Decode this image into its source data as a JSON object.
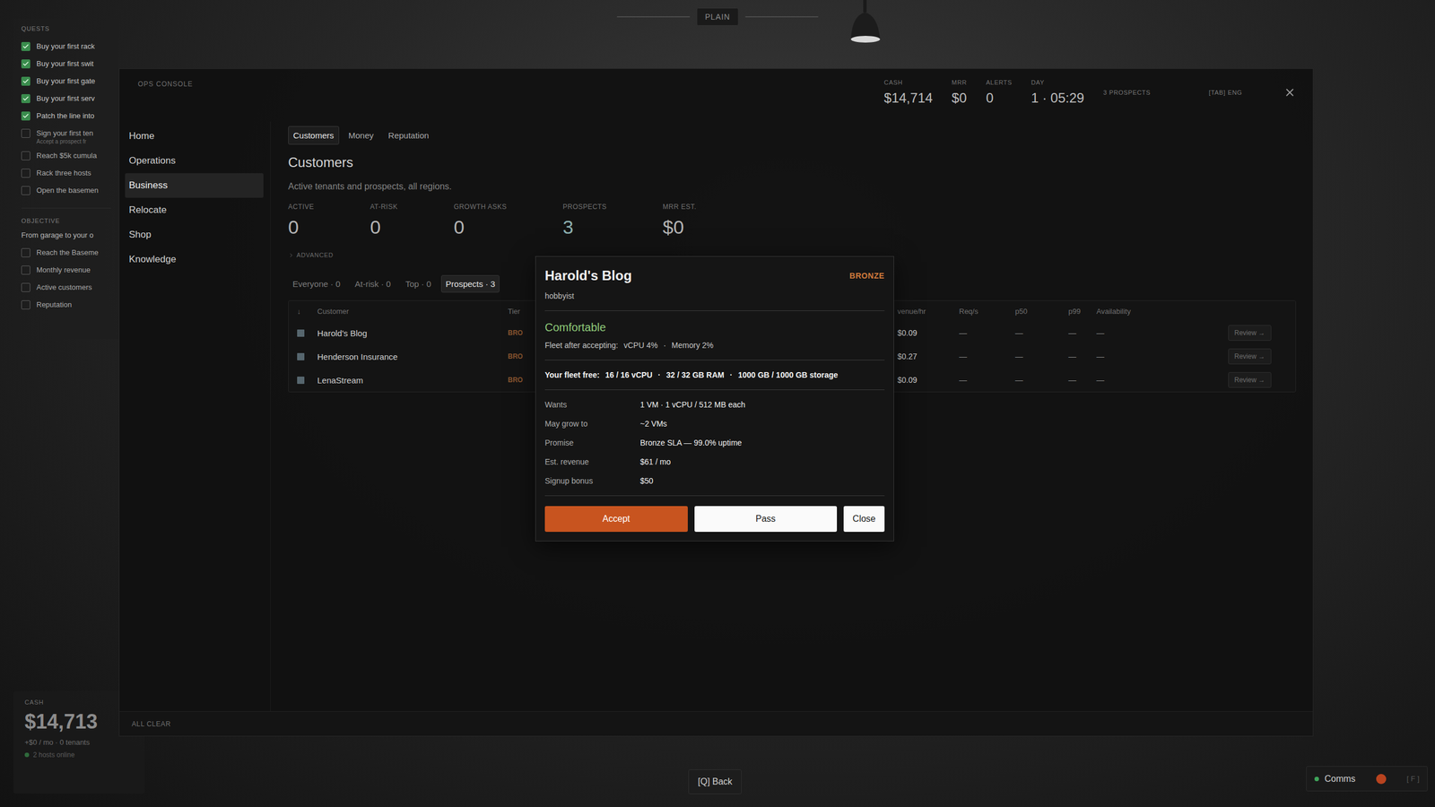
{
  "scene": {
    "mode_pill": "PLAIN"
  },
  "quests": {
    "title": "QUESTS",
    "items": [
      {
        "label": "Buy your first rack",
        "checked": true
      },
      {
        "label": "Buy your first swit",
        "checked": true
      },
      {
        "label": "Buy your first gate",
        "checked": true
      },
      {
        "label": "Buy your first serv",
        "checked": true
      },
      {
        "label": "Patch the line into",
        "checked": true
      },
      {
        "label": "Sign your first ten",
        "checked": false,
        "hint": "Accept a prospect fr"
      },
      {
        "label": "Reach $5k cumula",
        "checked": false
      },
      {
        "label": "Rack three hosts",
        "checked": false
      },
      {
        "label": "Open the basemen",
        "checked": false
      }
    ]
  },
  "objective": {
    "title": "OBJECTIVE",
    "name": "From garage to your o",
    "items": [
      {
        "label": "Reach the Baseme",
        "checked": false
      },
      {
        "label": "Monthly revenue",
        "checked": false
      },
      {
        "label": "Active customers",
        "checked": false
      },
      {
        "label": "Reputation",
        "checked": false
      }
    ]
  },
  "hud_cash": {
    "label": "CASH",
    "value": "$14,713",
    "rate": "+$0 / mo · 0 tenants",
    "status": "2 hosts online"
  },
  "console": {
    "title": "OPS CONSOLE",
    "stats": [
      {
        "label": "CASH",
        "value": "$14,714"
      },
      {
        "label": "MRR",
        "value": "$0"
      },
      {
        "label": "ALERTS",
        "value": "0"
      },
      {
        "label": "DAY",
        "value": "1 · 05:29"
      }
    ],
    "prospects_badge": "3 PROSPECTS",
    "hint": "[TAB] ENG",
    "sidebar": [
      {
        "label": "Home",
        "selected": false
      },
      {
        "label": "Operations",
        "selected": false
      },
      {
        "label": "Business",
        "selected": true
      },
      {
        "label": "Relocate",
        "selected": false
      },
      {
        "label": "Shop",
        "selected": false
      },
      {
        "label": "Knowledge",
        "selected": false
      }
    ],
    "tabs": [
      {
        "label": "Customers",
        "selected": true
      },
      {
        "label": "Money",
        "selected": false
      },
      {
        "label": "Reputation",
        "selected": false
      }
    ],
    "page": {
      "title": "Customers",
      "subtitle": "Active tenants and prospects, all regions."
    },
    "summary": [
      {
        "label": "ACTIVE",
        "value": "0",
        "highlight": false
      },
      {
        "label": "AT-RISK",
        "value": "0",
        "highlight": false
      },
      {
        "label": "GROWTH ASKS",
        "value": "0",
        "highlight": false
      },
      {
        "label": "PROSPECTS",
        "value": "3",
        "highlight": true
      },
      {
        "label": "MRR EST.",
        "value": "$0",
        "highlight": false
      }
    ],
    "advanced": {
      "label": "ADVANCED",
      "expanded": false
    },
    "filters": [
      {
        "label": "Everyone · 0",
        "selected": false
      },
      {
        "label": "At-risk · 0",
        "selected": false
      },
      {
        "label": "Top · 0",
        "selected": false
      },
      {
        "label": "Prospects · 3",
        "selected": true
      }
    ],
    "table": {
      "columns": [
        "↓",
        "Customer",
        "Tier",
        "venue/hr",
        "Req/s",
        "p50",
        "p99",
        "Availability"
      ],
      "rows": [
        {
          "name": "Harold's Blog",
          "tier": "BRO",
          "revenue": "$0.09",
          "req": "—",
          "p50": "—",
          "p99": "—",
          "availability": "—",
          "action": "Review →"
        },
        {
          "name": "Henderson Insurance",
          "tier": "BRO",
          "revenue": "$0.27",
          "req": "—",
          "p50": "—",
          "p99": "—",
          "availability": "—",
          "action": "Review →"
        },
        {
          "name": "LenaStream",
          "tier": "BRO",
          "revenue": "$0.09",
          "req": "—",
          "p50": "—",
          "p99": "—",
          "availability": "—",
          "action": "Review →"
        }
      ]
    },
    "status_bar": "ALL CLEAR"
  },
  "modal": {
    "title": "Harold's Blog",
    "tier": "BRONZE",
    "segment": "hobbyist",
    "fit": "Comfortable",
    "fleet_after": {
      "label": "Fleet after accepting:",
      "parts": [
        "vCPU 4%",
        "Memory 2%"
      ]
    },
    "fleet_free": {
      "label": "Your fleet free:",
      "parts": [
        "16 / 16 vCPU",
        "32 / 32 GB RAM",
        "1000 GB / 1000 GB storage"
      ]
    },
    "separator": "·",
    "details": [
      {
        "label": "Wants",
        "value": "1 VM · 1 vCPU / 512 MB each"
      },
      {
        "label": "May grow to",
        "value": "~2 VMs"
      },
      {
        "label": "Promise",
        "value": "Bronze SLA — 99.0% uptime"
      },
      {
        "label": "Est. revenue",
        "value": "$61 / mo"
      },
      {
        "label": "Signup bonus",
        "value": "$50"
      }
    ],
    "buttons": [
      {
        "label": "Accept",
        "kind": "primary"
      },
      {
        "label": "Pass",
        "kind": "secondary"
      },
      {
        "label": "Close",
        "kind": "secondary"
      }
    ]
  },
  "footer": {
    "back": "[Q] Back",
    "comms": {
      "label": "Comms",
      "key": "[ F ]"
    }
  }
}
